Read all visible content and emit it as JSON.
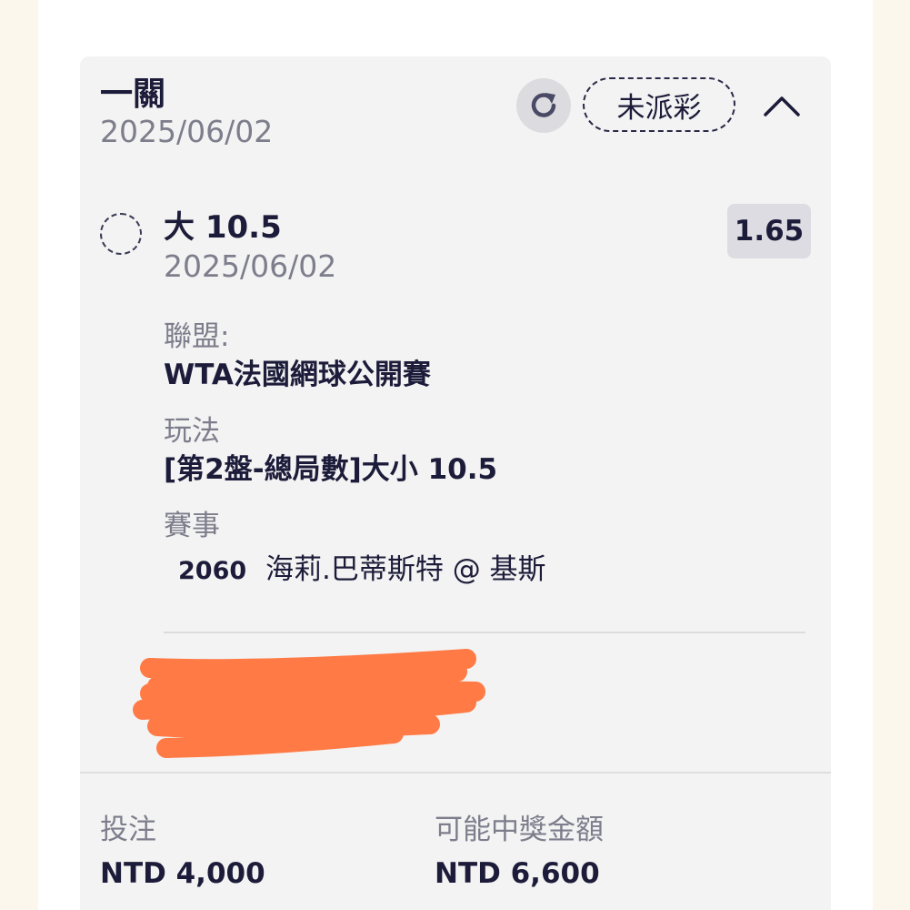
{
  "bet": {
    "type_title": "一關",
    "date": "2025/06/02",
    "status": "未派彩",
    "icons": {
      "refresh": "refresh-icon",
      "collapse": "chevron-up-icon"
    }
  },
  "selection": {
    "name": "大 10.5",
    "date": "2025/06/02",
    "odds": "1.65",
    "league_label": "聯盟:",
    "league_value": "WTA法國網球公開賽",
    "play_label": "玩法",
    "play_value": "[第2盤-總局數]大小 10.5",
    "event_label": "賽事",
    "event_id": "2060",
    "event_name": "海莉.巴蒂斯特 @ 基斯"
  },
  "footer": {
    "stake_label": "投注",
    "stake_value": "NTD 4,000",
    "payout_label": "可能中獎金額",
    "payout_value": "NTD 6,600"
  },
  "colors": {
    "redaction": "#ff7a45",
    "text_dark": "#1c1c3a",
    "text_muted": "#7d7d8c",
    "card_bg": "#f3f3f3"
  }
}
